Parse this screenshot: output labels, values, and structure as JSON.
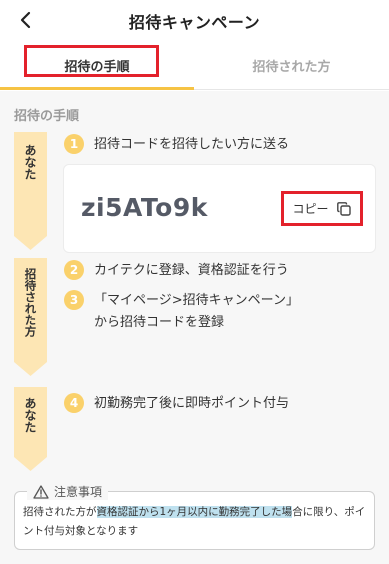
{
  "header": {
    "title": "招待キャンペーン",
    "back_icon": "chevron-left-icon"
  },
  "tabs": [
    {
      "label": "招待の手順",
      "active": true
    },
    {
      "label": "招待された方",
      "active": false
    }
  ],
  "colors": {
    "accent": "#f6c344",
    "step_badge": "#fad16b",
    "ribbon": "#fde6b4",
    "highlight_box": "#e3212b",
    "text_highlight": "#bfe1ef"
  },
  "section_title": "招待の手順",
  "actors": {
    "you_1": "あなた",
    "invitee": "招待された方",
    "you_2": "あなた"
  },
  "steps": [
    {
      "number": "1",
      "text": "招待コードを招待したい方に送る"
    },
    {
      "number": "2",
      "text": "カイテクに登録、資格認証を行う"
    },
    {
      "number": "3",
      "line1": "「マイページ>招待キャンペーン」",
      "line2": "から招待コードを登録"
    },
    {
      "number": "4",
      "text": "初勤務完了後に即時ポイント付与"
    }
  ],
  "invite_code": {
    "value": "zi5ATo9k",
    "copy_label": "コピー",
    "copy_icon": "copy-icon"
  },
  "notes": {
    "title": "注意事項",
    "icon": "warning-icon",
    "text_before": "招待された方が",
    "text_highlight": "資格認証から1ヶ月以内に勤務完了した場",
    "text_after": "合に限り、ポイント付与対象となります"
  }
}
